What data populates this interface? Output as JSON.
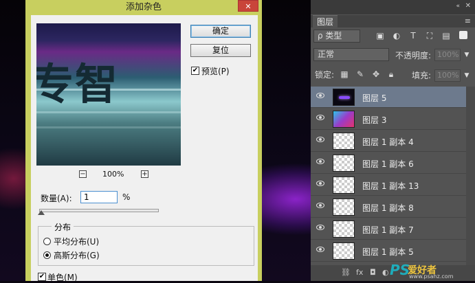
{
  "dialog": {
    "title": "添加杂色",
    "close": "✕",
    "ok_label": "确定",
    "reset_label": "复位",
    "preview_label": "预览(P)",
    "preview_checked": true,
    "preview_text": "专智",
    "zoom_out": "−",
    "zoom_in": "+",
    "zoom_level": "100%",
    "amount_label": "数量(A):",
    "amount_value": "1",
    "amount_unit": "%",
    "distribution_label": "分布",
    "uniform_label": "平均分布(U)",
    "gaussian_label": "高斯分布(G)",
    "selected_distribution": "gaussian",
    "mono_label": "单色(M)",
    "mono_checked": true
  },
  "layers_panel": {
    "tab_label": "图层",
    "collapse_icon": "«",
    "close_icon": "✕",
    "menu_icon": "≡",
    "filter_label": "ρ 类型",
    "blend_mode": "正常",
    "opacity_label": "不透明度:",
    "opacity_value": "100%",
    "lock_label": "锁定:",
    "fill_label": "填充:",
    "fill_value": "100%",
    "layers": [
      {
        "name": "图层 5",
        "thumb": "dark",
        "active": true
      },
      {
        "name": "图层 3",
        "thumb": "grad",
        "active": false
      },
      {
        "name": "图层 1 副本 4",
        "thumb": "checker",
        "active": false
      },
      {
        "name": "图层 1 副本 6",
        "thumb": "checker",
        "active": false
      },
      {
        "name": "图层 1 副本 13",
        "thumb": "checker",
        "active": false
      },
      {
        "name": "图层 1 副本 8",
        "thumb": "checker",
        "active": false
      },
      {
        "name": "图层 1 副本 7",
        "thumb": "checker",
        "active": false
      },
      {
        "name": "图层 1 副本 5",
        "thumb": "checker",
        "active": false
      }
    ],
    "bottom_icons": [
      "fx",
      "◘",
      "◐",
      "▢",
      "▤",
      "🗑"
    ]
  },
  "watermark": {
    "ps": "PS",
    "cn": "爱好者",
    "url": "www.psahz.com"
  },
  "colors": {
    "dialog_frame": "#c8cf5f",
    "panel_bg": "#535353",
    "active_layer": "#6d7a8d",
    "accent_border": "#4a8fd0"
  }
}
